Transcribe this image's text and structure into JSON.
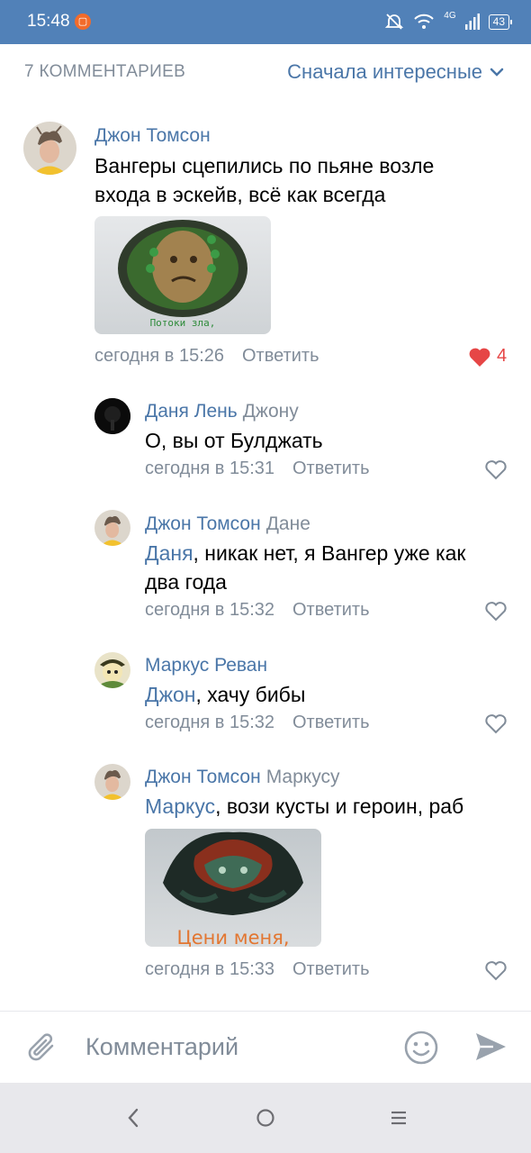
{
  "status_bar": {
    "time": "15:48",
    "network": "4G",
    "battery": "43"
  },
  "header": {
    "count_label": "7 КОММЕНТАРИЕВ",
    "sort_label": "Сначала интересные"
  },
  "comments": [
    {
      "author": "Джон Томсон",
      "reply_to": "",
      "text": "Вангеры сцепились по пьяне возле входа в эскейв, всё как всегда",
      "attachment_caption": "Потоки зла,",
      "time": "сегодня в 15:26",
      "reply_label": "Ответить",
      "likes": "4",
      "liked": true
    },
    {
      "author": "Даня Лень",
      "reply_to": "Джону",
      "text": "О, вы от Булджать",
      "time": "сегодня в 15:31",
      "reply_label": "Ответить"
    },
    {
      "author": "Джон Томсон",
      "reply_to": "Дане",
      "mention": "Даня",
      "text": ", никак нет, я Вангер уже как два года",
      "time": "сегодня в 15:32",
      "reply_label": "Ответить"
    },
    {
      "author": "Маркус Реван",
      "reply_to": "",
      "mention": "Джон",
      "text": ", хачу бибы",
      "time": "сегодня в 15:32",
      "reply_label": "Ответить"
    },
    {
      "author": "Джон Томсон",
      "reply_to": "Маркусу",
      "mention": "Маркус",
      "text": ", вози кусты и героин, раб",
      "attachment_caption": "Цени меня,",
      "time": "сегодня в 15:33",
      "reply_label": "Ответить"
    }
  ],
  "input": {
    "placeholder": "Комментарий"
  },
  "colors": {
    "accent": "#4a76a8",
    "statusbar": "#5181b8",
    "secondary": "#818c99",
    "like": "#e64646"
  },
  "icons": [
    "attach-icon",
    "emoji-icon",
    "send-icon",
    "back-icon",
    "home-icon",
    "menu-icon",
    "heart-icon",
    "chevron-down-icon"
  ]
}
